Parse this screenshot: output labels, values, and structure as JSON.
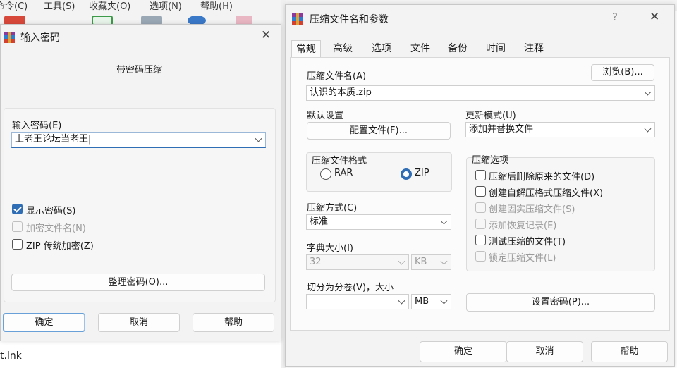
{
  "background": {
    "menu": [
      "命令(C)",
      "工具(S)",
      "收藏夹(O)",
      "选项(N)",
      "帮助(H)"
    ],
    "file_name": "t.lnk"
  },
  "password_dialog": {
    "title": "输入密码",
    "subtitle": "带密码压缩",
    "password_label": "输入密码(E)",
    "password_value": "上老王论坛当老王",
    "show_password": "显示密码(S)",
    "encrypt_filenames": "加密文件名(N)",
    "zip_legacy": "ZIP 传统加密(Z)",
    "organize_button": "整理密码(O)...",
    "ok": "确定",
    "cancel": "取消",
    "help": "帮助",
    "show_password_checked": true,
    "encrypt_filenames_enabled": false,
    "zip_legacy_checked": false
  },
  "archive_dialog": {
    "title": "压缩文件名和参数",
    "help_glyph": "?",
    "tabs": [
      "常规",
      "高级",
      "选项",
      "文件",
      "备份",
      "时间",
      "注释"
    ],
    "active_tab": "常规",
    "archive_name_label": "压缩文件名(A)",
    "browse_button": "浏览(B)...",
    "archive_name_value": "认识的本质.zip",
    "default_settings_label": "默认设置",
    "profiles_button": "配置文件(F)...",
    "update_mode_label": "更新模式(U)",
    "update_mode_value": "添加并替换文件",
    "format_group_label": "压缩文件格式",
    "format_rar": "RAR",
    "format_zip": "ZIP",
    "selected_format": "ZIP",
    "options_group_label": "压缩选项",
    "options": [
      {
        "label": "压缩后删除原来的文件(D)",
        "enabled": true,
        "checked": false
      },
      {
        "label": "创建自解压格式压缩文件(X)",
        "enabled": true,
        "checked": false
      },
      {
        "label": "创建固实压缩文件(S)",
        "enabled": false,
        "checked": false
      },
      {
        "label": "添加恢复记录(E)",
        "enabled": false,
        "checked": false
      },
      {
        "label": "测试压缩的文件(T)",
        "enabled": true,
        "checked": false
      },
      {
        "label": "锁定压缩文件(L)",
        "enabled": false,
        "checked": false
      }
    ],
    "method_label": "压缩方式(C)",
    "method_value": "标准",
    "dict_label": "字典大小(I)",
    "dict_value": "32",
    "dict_unit": "KB",
    "split_label": "切分为分卷(V)，大小",
    "split_value": "",
    "split_unit": "MB",
    "set_password_button": "设置密码(P)...",
    "ok": "确定",
    "cancel": "取消",
    "help": "帮助"
  },
  "colors": {
    "accent": "#2f6db5",
    "dialog_bg": "#f3f3f3"
  }
}
